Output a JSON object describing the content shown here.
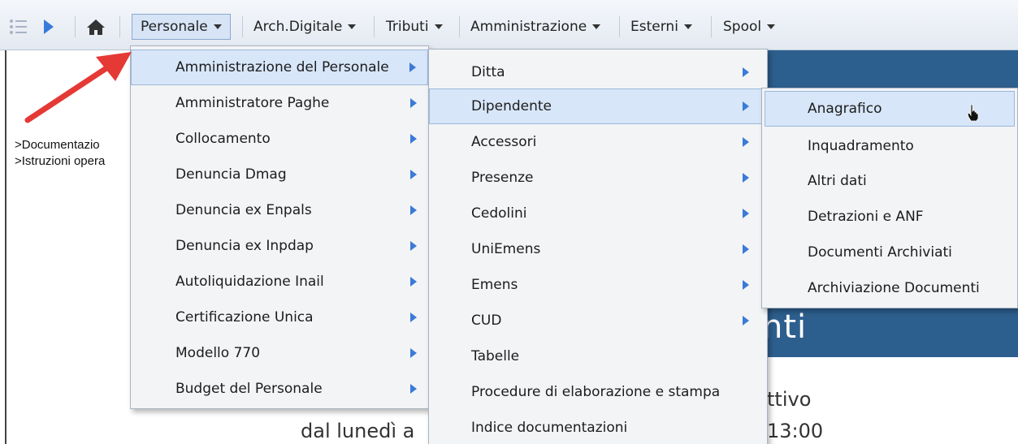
{
  "toolbar": {
    "menus": [
      {
        "label": "Personale"
      },
      {
        "label": "Arch.Digitale"
      },
      {
        "label": "Tributi"
      },
      {
        "label": "Amministrazione"
      },
      {
        "label": "Esterni"
      },
      {
        "label": "Spool"
      }
    ]
  },
  "page": {
    "left_links": [
      ">Documentazio",
      ">Istruzioni opera"
    ],
    "title_fragment": "nti",
    "text_line1_right": "ttivo",
    "text_line2_left": "dal lunedì a",
    "text_line2_right": "13:00"
  },
  "menu_personale": [
    {
      "label": "Amministrazione del Personale"
    },
    {
      "label": "Amministratore Paghe"
    },
    {
      "label": "Collocamento"
    },
    {
      "label": "Denuncia Dmag"
    },
    {
      "label": "Denuncia ex Enpals"
    },
    {
      "label": "Denuncia ex Inpdap"
    },
    {
      "label": "Autoliquidazione Inail"
    },
    {
      "label": "Certificazione Unica"
    },
    {
      "label": "Modello 770"
    },
    {
      "label": "Budget del Personale"
    }
  ],
  "menu_amministrazione": [
    {
      "label": "Ditta"
    },
    {
      "label": "Dipendente"
    },
    {
      "label": "Accessori"
    },
    {
      "label": "Presenze"
    },
    {
      "label": "Cedolini"
    },
    {
      "label": "UniEmens"
    },
    {
      "label": "Emens"
    },
    {
      "label": "CUD"
    },
    {
      "label": "Tabelle"
    },
    {
      "label": "Procedure di elaborazione e stampa"
    },
    {
      "label": "Indice documentazioni"
    }
  ],
  "menu_dipendente": [
    {
      "label": "Anagrafico"
    },
    {
      "label": "Inquadramento"
    },
    {
      "label": "Altri dati"
    },
    {
      "label": "Detrazioni e ANF"
    },
    {
      "label": "Documenti Archiviati"
    },
    {
      "label": "Archiviazione Documenti"
    }
  ],
  "colors": {
    "accent": "#3a7ad8",
    "banner": "#2d5f8e",
    "highlight": "#d7e6f8",
    "annotation": "#e53935"
  },
  "icons": [
    "list-icon",
    "play-icon",
    "home-icon",
    "submenu-arrow-icon",
    "hand-cursor-icon",
    "annotation-arrow-icon"
  ]
}
